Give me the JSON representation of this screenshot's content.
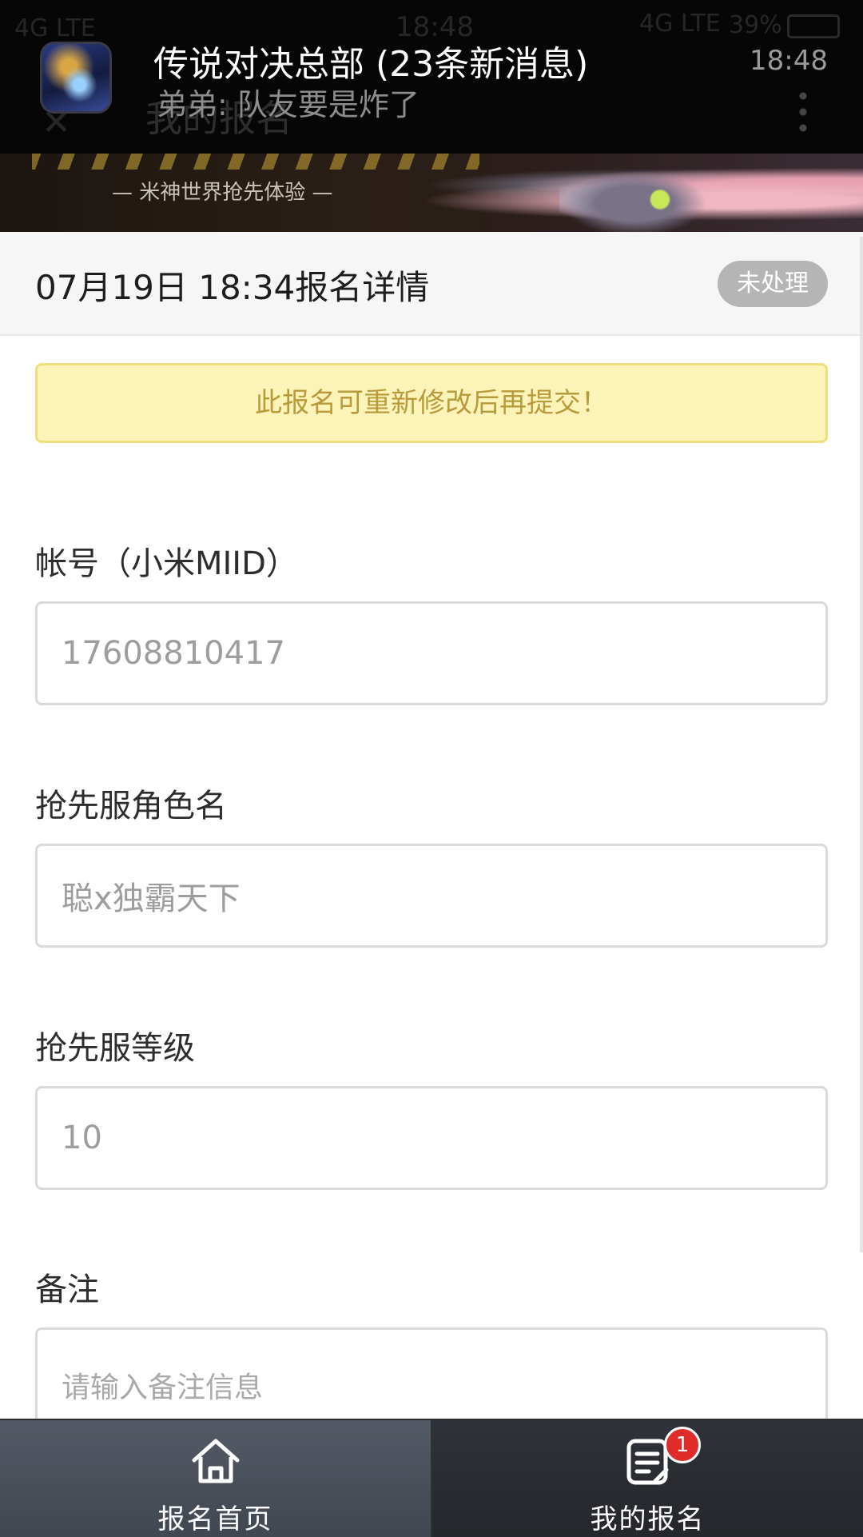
{
  "notification": {
    "status_network_left": "4G LTE",
    "status_time": "18:48",
    "status_network_right": "4G LTE",
    "battery_percent": "39%",
    "title": "传说对决总部 (23条新消息)",
    "time": "18:48",
    "preview": "弟弟: 队友要是炸了",
    "app_icon": "game-app-icon"
  },
  "page_title": "我的报名",
  "banner": {
    "tagline": "— 米神世界抢先体验 —"
  },
  "detail": {
    "title": "07月19日 18:34报名详情",
    "status": "未处理"
  },
  "notice": "此报名可重新修改后再提交！",
  "form": {
    "account": {
      "label": "帐号（小米MIID）",
      "value": "17608810417"
    },
    "role_name": {
      "label": "抢先服角色名",
      "value": "聪x独霸天下"
    },
    "level": {
      "label": "抢先服等级",
      "value": "10"
    },
    "remark": {
      "label": "备注",
      "placeholder": "请输入备注信息"
    }
  },
  "nav": {
    "home_label": "报名首页",
    "mine_label": "我的报名",
    "mine_badge": "1",
    "home_icon": "home-icon",
    "mine_icon": "document-list-icon"
  },
  "colors": {
    "notice_bg": "#fcf3b8",
    "notice_text": "#b89a3c",
    "badge_red": "#e02b2b",
    "status_badge_bg": "#b5b5b5"
  }
}
